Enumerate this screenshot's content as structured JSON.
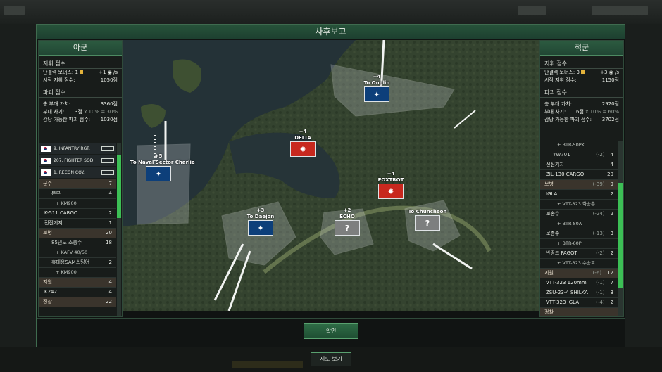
{
  "dialog": {
    "title": "사후보고",
    "confirm_label": "확인",
    "map_view_label": "지도 보기"
  },
  "left": {
    "header": "아군",
    "command_section": "지휘 점수",
    "occupancy_bonus_label": "단결력 보너스: 1",
    "occupancy_bonus_rate": "+1",
    "occupancy_bonus_unit": "/s",
    "start_command_label": "시작 지휘 점수:",
    "start_command_value": "1050점",
    "destruction_section": "파괴 점수",
    "total_value_label": "총 부대 가치:",
    "total_value": "3360점",
    "morale_label": "부대 사기:",
    "morale_value": "3점",
    "morale_formula": "x 10% = 30%",
    "destructible_label": "감당 가능한 파괴 점수:",
    "destructible_value": "1030점",
    "units": [
      {
        "name": "9. INFANTRY RGT."
      },
      {
        "name": "207. FIGHTER SQD."
      },
      {
        "name": "1. RECON COY."
      }
    ],
    "items": [
      {
        "type": "cat",
        "label": "군수",
        "count": "7"
      },
      {
        "type": "sub",
        "label": "본부",
        "count": "4"
      },
      {
        "type": "sub2",
        "label": "+ KM900",
        "count": ""
      },
      {
        "type": "item",
        "label": "K-511 CARGO",
        "count": "2"
      },
      {
        "type": "item",
        "label": "전진기지",
        "count": "1"
      },
      {
        "type": "cat",
        "label": "보병",
        "count": "20"
      },
      {
        "type": "sub",
        "label": "85년도 소총수",
        "count": "18"
      },
      {
        "type": "sub2",
        "label": "+ KAFV 40/50",
        "count": ""
      },
      {
        "type": "sub",
        "label": "휴대용SAM스팅어",
        "count": "2"
      },
      {
        "type": "sub2",
        "label": "+ KM900",
        "count": ""
      },
      {
        "type": "cat",
        "label": "지원",
        "count": "4"
      },
      {
        "type": "item",
        "label": "K242",
        "count": "4"
      },
      {
        "type": "cat",
        "label": "정찰",
        "count": "22"
      }
    ]
  },
  "right": {
    "header": "적군",
    "command_section": "지휘 점수",
    "occupancy_bonus_label": "단결력 보너스: 3",
    "occupancy_bonus_rate": "+3",
    "occupancy_bonus_unit": "/s",
    "start_command_label": "시작 지휘 점수:",
    "start_command_value": "1150점",
    "destruction_section": "파괴 점수",
    "total_value_label": "총 부대 가치:",
    "total_value": "2920점",
    "morale_label": "부대 사기:",
    "morale_value": "6점",
    "morale_formula": "x 10% = 60%",
    "destructible_label": "감당 가능한 파괴 점수:",
    "destructible_value": "3702점",
    "items": [
      {
        "type": "sub2",
        "label": "+ BTR-50PK",
        "mod": "",
        "count": ""
      },
      {
        "type": "sub",
        "label": "YW701",
        "mod": "(-2)",
        "count": "4"
      },
      {
        "type": "item",
        "label": "전진기지",
        "mod": "",
        "count": "4"
      },
      {
        "type": "item",
        "label": "ZIL-130 CARGO",
        "mod": "",
        "count": "20"
      },
      {
        "type": "cat",
        "label": "보병",
        "mod": "(-39)",
        "count": "9"
      },
      {
        "type": "item",
        "label": "IGLA",
        "mod": "",
        "count": "2"
      },
      {
        "type": "sub2",
        "label": "+ VTT-323 화송총",
        "mod": "",
        "count": ""
      },
      {
        "type": "item",
        "label": "보총수",
        "mod": "(-24)",
        "count": "2"
      },
      {
        "type": "sub2",
        "label": "+ BTR-80A",
        "mod": "",
        "count": ""
      },
      {
        "type": "item",
        "label": "보총수",
        "mod": "(-13)",
        "count": "3"
      },
      {
        "type": "sub2",
        "label": "+ BTR-60P",
        "mod": "",
        "count": ""
      },
      {
        "type": "item",
        "label": "반땅크 FAGOT",
        "mod": "(-2)",
        "count": "2"
      },
      {
        "type": "sub2",
        "label": "+ VTT-323 수송포",
        "mod": "",
        "count": ""
      },
      {
        "type": "cat",
        "label": "지원",
        "mod": "(-6)",
        "count": "12"
      },
      {
        "type": "item",
        "label": "VTT-323 120mm",
        "mod": "(-1)",
        "count": "7"
      },
      {
        "type": "item",
        "label": "ZSU-23-4 SHILKA",
        "mod": "(-1)",
        "count": "3"
      },
      {
        "type": "item",
        "label": "VTT-323 IGLA",
        "mod": "(-4)",
        "count": "2"
      },
      {
        "type": "cat",
        "label": "정찰",
        "mod": "",
        "count": ""
      }
    ]
  },
  "map": {
    "sectors": [
      {
        "name": "To Onglin",
        "points": "+4",
        "owner": "nato"
      },
      {
        "name": "DELTA",
        "points": "+4",
        "owner": "enemy"
      },
      {
        "name": "To Naval Sector Charlie",
        "points": "+5",
        "owner": "nato"
      },
      {
        "name": "FOXTROT",
        "points": "+4",
        "owner": "enemy"
      },
      {
        "name": "To Daejon",
        "points": "+3",
        "owner": "nato"
      },
      {
        "name": "ECHO",
        "points": "+2",
        "owner": "neutral"
      },
      {
        "name": "To Chuncheon",
        "points": "",
        "owner": "neutral"
      }
    ],
    "unknown_symbol": "?"
  },
  "colors": {
    "accent_green": "#2e6b45",
    "nato_blue": "#0d3f7a",
    "enemy_red": "#c8281e"
  }
}
